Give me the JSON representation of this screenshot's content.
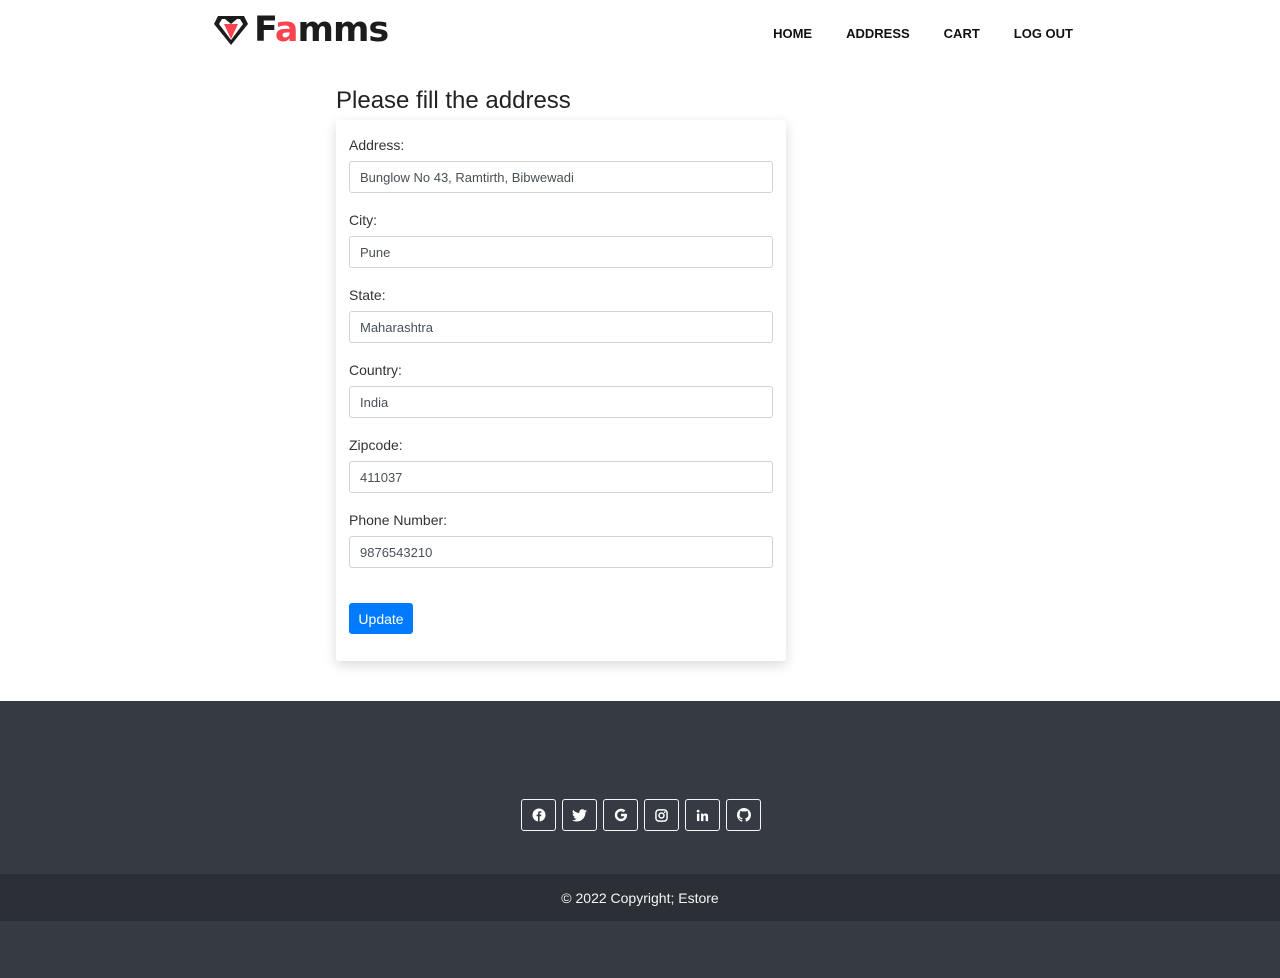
{
  "brand": {
    "name_part1": "F",
    "name_accent": "a",
    "name_part2": "mms",
    "accent_color": "#f7444e"
  },
  "nav": {
    "items": [
      {
        "label": "HOME"
      },
      {
        "label": "ADDRESS"
      },
      {
        "label": "CART"
      },
      {
        "label": "LOG OUT"
      }
    ]
  },
  "form": {
    "heading": "Please fill the address",
    "fields": [
      {
        "label": "Address:",
        "value": "Bunglow No 43, Ramtirth, Bibwewadi"
      },
      {
        "label": "City:",
        "value": "Pune"
      },
      {
        "label": "State:",
        "value": "Maharashtra"
      },
      {
        "label": "Country:",
        "value": "India"
      },
      {
        "label": "Zipcode:",
        "value": "411037"
      },
      {
        "label": "Phone Number:",
        "value": "9876543210"
      }
    ],
    "submit_label": "Update",
    "submit_color": "#007bff"
  },
  "footer": {
    "social_icons": [
      "facebook-icon",
      "twitter-icon",
      "google-icon",
      "instagram-icon",
      "linkedin-icon",
      "github-icon"
    ],
    "copyright": "© 2022 Copyright; Estore",
    "background_color": "#353a43",
    "copyright_bar_color": "#2c2f35"
  }
}
